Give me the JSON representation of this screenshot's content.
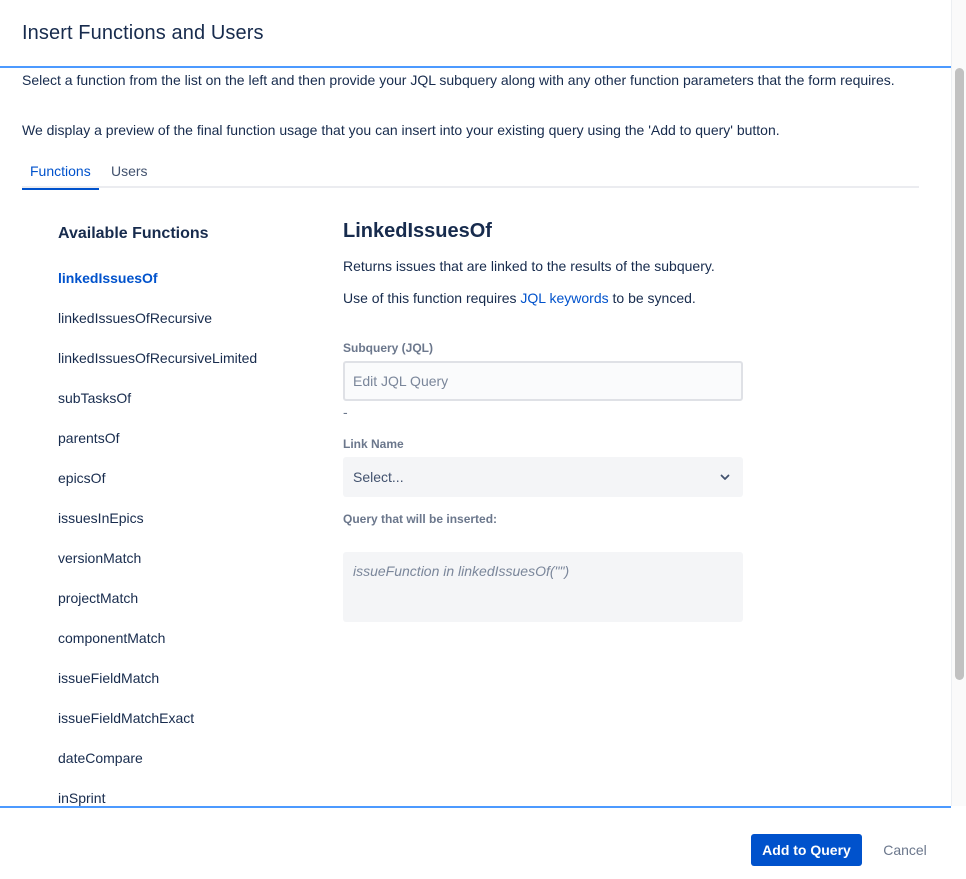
{
  "dialog": {
    "title": "Insert Functions and Users"
  },
  "intro": {
    "line1": "Select a function from the list on the left and then provide your JQL subquery along with any other function parameters that the form requires.",
    "line2": "We display a preview of the final function usage that you can insert into your existing query using the 'Add to query' button."
  },
  "tabs": [
    {
      "label": "Functions",
      "active": true
    },
    {
      "label": "Users",
      "active": false
    }
  ],
  "functions": {
    "title": "Available Functions",
    "items": [
      {
        "label": "linkedIssuesOf",
        "selected": true
      },
      {
        "label": "linkedIssuesOfRecursive",
        "selected": false
      },
      {
        "label": "linkedIssuesOfRecursiveLimited",
        "selected": false
      },
      {
        "label": "subTasksOf",
        "selected": false
      },
      {
        "label": "parentsOf",
        "selected": false
      },
      {
        "label": "epicsOf",
        "selected": false
      },
      {
        "label": "issuesInEpics",
        "selected": false
      },
      {
        "label": "versionMatch",
        "selected": false
      },
      {
        "label": "projectMatch",
        "selected": false
      },
      {
        "label": "componentMatch",
        "selected": false
      },
      {
        "label": "issueFieldMatch",
        "selected": false
      },
      {
        "label": "issueFieldMatchExact",
        "selected": false
      },
      {
        "label": "dateCompare",
        "selected": false
      },
      {
        "label": "inSprint",
        "selected": false
      }
    ]
  },
  "detail": {
    "title": "LinkedIssuesOf",
    "description": "Returns issues that are linked to the results of the subquery.",
    "note_prefix": "Use of this function requires ",
    "note_link": "JQL keywords",
    "note_suffix": " to be synced.",
    "subquery_label": "Subquery (JQL)",
    "subquery_value": "",
    "subquery_placeholder": "Edit JQL Query",
    "dash": "-",
    "link_name_label": "Link Name",
    "link_name_value": "Select...",
    "query_label": "Query that will be inserted:",
    "query_preview": "issueFunction in linkedIssuesOf(\"\")"
  },
  "footer": {
    "add_label": "Add to Query",
    "cancel_label": "Cancel"
  },
  "colors": {
    "accent": "#0052cc",
    "divider": "#4c9aff",
    "text": "#172b4d",
    "muted": "#6b778c"
  }
}
